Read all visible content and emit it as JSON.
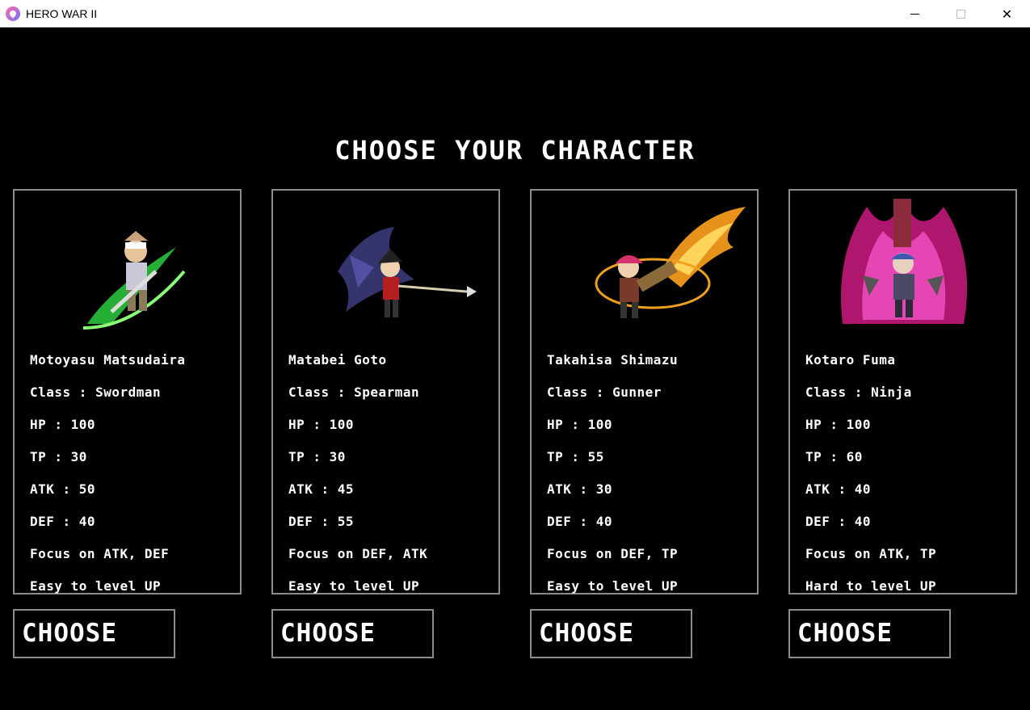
{
  "window": {
    "title": "HERO WAR II",
    "controls": {
      "minimize": "minimize",
      "maximize": "maximize",
      "close": "✕"
    }
  },
  "screen": {
    "heading": "CHOOSE YOUR CHARACTER",
    "choose_label": "CHOOSE"
  },
  "characters": [
    {
      "name": "Motoyasu Matsudaira",
      "class": "Class : Swordman",
      "hp": "HP : 100",
      "tp": "TP : 30",
      "atk": "ATK : 50",
      "def": "DEF : 40",
      "focus": "Focus on ATK, DEF",
      "difficulty": "Easy to level UP",
      "portrait": "swordman-sprite"
    },
    {
      "name": "Matabei Goto",
      "class": "Class : Spearman",
      "hp": "HP : 100",
      "tp": "TP : 30",
      "atk": "ATK : 45",
      "def": "DEF : 55",
      "focus": "Focus on DEF, ATK",
      "difficulty": "Easy to level UP",
      "portrait": "spearman-sprite"
    },
    {
      "name": "Takahisa Shimazu",
      "class": "Class : Gunner",
      "hp": "HP : 100",
      "tp": "TP : 55",
      "atk": "ATK : 30",
      "def": "DEF : 40",
      "focus": "Focus on DEF, TP",
      "difficulty": "Easy to level UP",
      "portrait": "gunner-sprite"
    },
    {
      "name": "Kotaro Fuma",
      "class": "Class : Ninja",
      "hp": "HP : 100",
      "tp": "TP : 60",
      "atk": "ATK : 40",
      "def": "DEF : 40",
      "focus": "Focus on ATK, TP",
      "difficulty": "Hard to level UP",
      "portrait": "ninja-sprite"
    }
  ],
  "colors": {
    "background": "#000000",
    "border": "#8c8c8c",
    "text": "#ffffff"
  }
}
